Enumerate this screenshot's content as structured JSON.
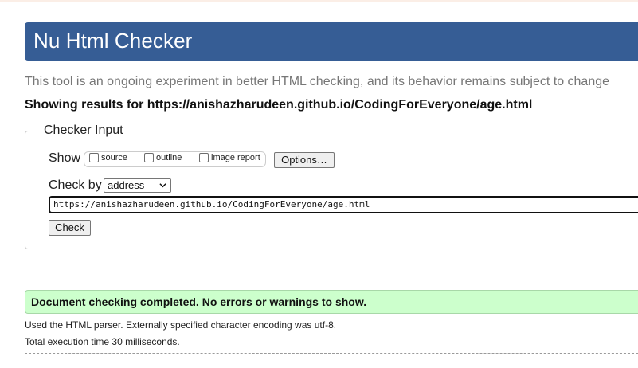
{
  "header": {
    "title": "Nu Html Checker"
  },
  "tagline": "This tool is an ongoing experiment in better HTML checking, and its behavior remains subject to change",
  "showing_results": "Showing results for https://anishazharudeen.github.io/CodingForEveryone/age.html",
  "checker_input": {
    "legend": "Checker Input",
    "show_label": "Show",
    "options": [
      {
        "label": "source",
        "checked": false
      },
      {
        "label": "outline",
        "checked": false
      },
      {
        "label": "image report",
        "checked": false
      }
    ],
    "options_button": "Options…",
    "check_by_label": "Check by",
    "check_by_value": "address",
    "url_value": "https://anishazharudeen.github.io/CodingForEveryone/age.html",
    "check_button": "Check"
  },
  "result": {
    "success_message": "Document checking completed. No errors or warnings to show.",
    "parser_info": "Used the HTML parser. Externally specified character encoding was utf-8.",
    "execution_time": "Total execution time 30 milliseconds."
  },
  "colors": {
    "banner": "#365d95",
    "success_bg": "#ccffcc"
  }
}
